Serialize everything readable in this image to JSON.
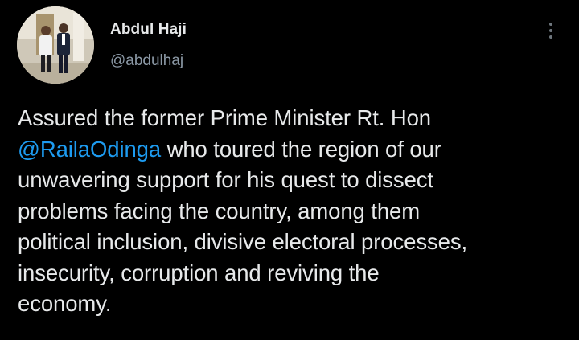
{
  "author": {
    "display_name": "Abdul Haji",
    "handle": "@abdulhaj",
    "avatar_icon": "profile-photo"
  },
  "menu": {
    "icon": "more-vertical-icon"
  },
  "tweet": {
    "line1": "Assured the former Prime Minister Rt. Hon",
    "mention": "@RailaOdinga",
    "line2_rest": " who toured the region of our",
    "line3": "unwavering support for his quest to dissect",
    "line4": "problems facing the country, among them",
    "line5": "political inclusion, divisive electoral processes,",
    "line6": "insecurity, corruption and reviving the",
    "line7": "economy."
  },
  "colors": {
    "background": "#000000",
    "text": "#e7e9ea",
    "secondary_text": "#8b98a5",
    "link": "#1d9bf0"
  }
}
